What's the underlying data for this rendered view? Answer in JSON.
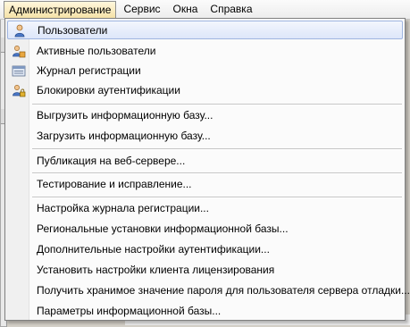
{
  "menubar": {
    "items": [
      {
        "label": "Администрирование",
        "active": true
      },
      {
        "label": "Сервис"
      },
      {
        "label": "Окна"
      },
      {
        "label": "Справка"
      }
    ]
  },
  "menu": {
    "items": [
      {
        "label": "Пользователи",
        "icon": "user-icon",
        "highlighted": true
      },
      {
        "label": "Активные пользователи",
        "icon": "active-users-icon"
      },
      {
        "label": "Журнал регистрации",
        "icon": "event-log-icon"
      },
      {
        "label": "Блокировки аутентификации",
        "icon": "auth-lock-icon"
      },
      {
        "label": "Выгрузить информационную базу..."
      },
      {
        "label": "Загрузить информационную базу..."
      },
      {
        "label": "Публикация на веб-сервере..."
      },
      {
        "label": "Тестирование и исправление..."
      },
      {
        "label": "Настройка журнала регистрации..."
      },
      {
        "label": "Региональные установки информационной базы..."
      },
      {
        "label": "Дополнительные настройки аутентификации..."
      },
      {
        "label": "Установить настройки клиента лицензирования"
      },
      {
        "label": "Получить хранимое значение пароля для пользователя сервера отладки..."
      },
      {
        "label": "Параметры информационной базы..."
      }
    ]
  }
}
